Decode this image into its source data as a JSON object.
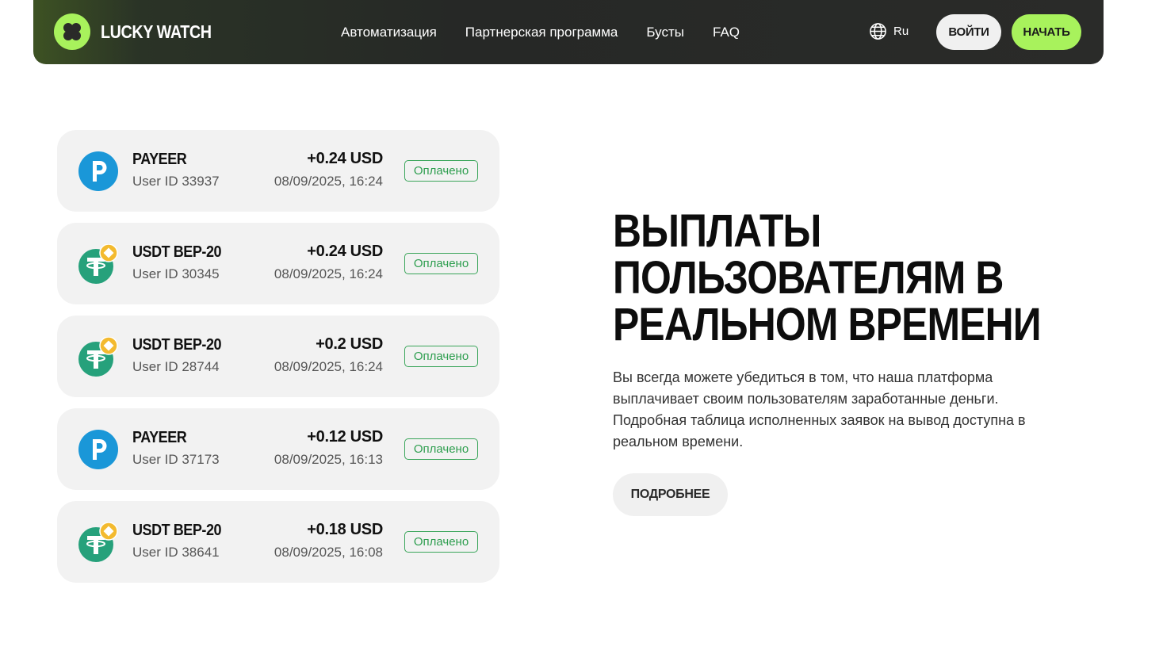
{
  "brand": {
    "name": "LUCKY WATCH",
    "accent_color": "#a8f25c"
  },
  "nav": {
    "items": [
      {
        "label": "Автоматизация"
      },
      {
        "label": "Партнерская программа"
      },
      {
        "label": "Бусты"
      },
      {
        "label": "FAQ"
      }
    ],
    "language": "Ru",
    "login_label": "ВОЙТИ",
    "start_label": "НАЧАТЬ"
  },
  "payouts": [
    {
      "method": "PAYEER",
      "icon": "payeer-icon",
      "user": "User ID 33937",
      "amount": "+0.24 USD",
      "date": "08/09/2025, 16:24",
      "status": "Оплачено"
    },
    {
      "method": "USDT BEP-20",
      "icon": "tether-icon",
      "user": "User ID 30345",
      "amount": "+0.24 USD",
      "date": "08/09/2025, 16:24",
      "status": "Оплачено"
    },
    {
      "method": "USDT BEP-20",
      "icon": "tether-icon",
      "user": "User ID 28744",
      "amount": "+0.2 USD",
      "date": "08/09/2025, 16:24",
      "status": "Оплачено"
    },
    {
      "method": "PAYEER",
      "icon": "payeer-icon",
      "user": "User ID 37173",
      "amount": "+0.12 USD",
      "date": "08/09/2025, 16:13",
      "status": "Оплачено"
    },
    {
      "method": "USDT BEP-20",
      "icon": "tether-icon",
      "user": "User ID 38641",
      "amount": "+0.18 USD",
      "date": "08/09/2025, 16:08",
      "status": "Оплачено"
    }
  ],
  "hero": {
    "title_lines": [
      "ВЫПЛАТЫ",
      "ПОЛЬЗОВАТЕЛЯМ В",
      "РЕАЛЬНОМ ВРЕМЕНИ"
    ],
    "description": "Вы всегда можете убедиться в том, что наша платформа выплачивает своим пользователям заработанные деньги. Подробная таблица исполненных заявок на вывод доступна в реальном времени.",
    "more_label": "ПОДРОБНЕЕ"
  }
}
